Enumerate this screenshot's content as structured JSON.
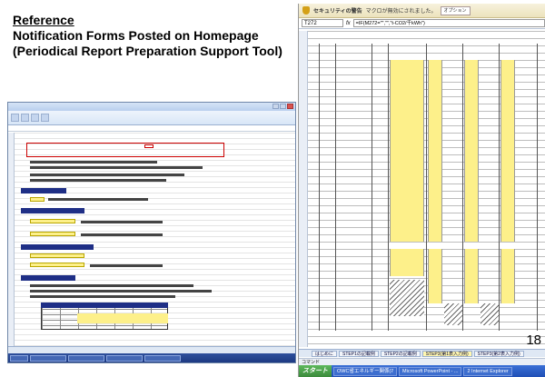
{
  "slide": {
    "heading": "Reference",
    "line1": "Notification Forms Posted on Homepage",
    "line2": "(Periodical Report Preparation Support Tool)",
    "page_number": "18"
  },
  "right_window": {
    "security_warning_title": "セキュリティの警告",
    "security_warning_message": "マクロが無効にされました。",
    "options_button": "オプション",
    "cell_reference": "T272",
    "formula": "=IF(M272=\"\",\"\",\"t-CO2/千kWh\")",
    "sheet_tabs": [
      "はじめに",
      "STEP1の記載例",
      "STEP2の記載例",
      "STEP3(第1表入力例)",
      "STEP3(第2表入力例)"
    ],
    "command_label": "コマンド",
    "start_label": "スタート",
    "taskbar_items": [
      "OWC省エネルギー関係(ﾏ",
      "Microsoft PowerPoint - ...",
      "2 Internet Explorer"
    ]
  },
  "colors": {
    "form_yellow": "#fdf08a",
    "section_blue": "#1f2f86",
    "highlight_red": "#cc0000"
  }
}
